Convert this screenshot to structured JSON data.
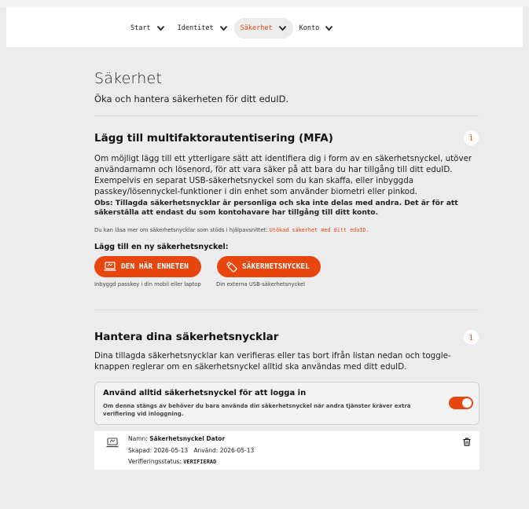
{
  "nav": {
    "items": [
      {
        "label": "Start"
      },
      {
        "label": "Identitet"
      },
      {
        "label": "Säkerhet"
      },
      {
        "label": "Konto"
      }
    ]
  },
  "page": {
    "title": "Säkerhet",
    "lead": "Öka och hantera säkerheten för ditt eduID."
  },
  "mfa": {
    "heading": "Lägg till multifaktorautentisering (MFA)",
    "info_icon": "i",
    "description": "Om möjligt lägg till ett ytterligare sätt att identifiera dig i form av en säkerhetsnyckel, utöver användarnamn och lösenord, för att vara säker på att bara du har tillgång till ditt eduID. Exempelvis en separat USB-säkerhetsnyckel som du kan skaffa, eller inbyggda passkey/lösennyckel-funktioner i din enhet som använder biometri eller pinkod.",
    "note": "Obs: Tillagda säkerhetsnycklar är personliga och ska inte delas med andra. Det är för att säkerställa att endast du som kontohavare har tillgång till ditt konto.",
    "help_prefix": "Du kan läsa mer om säkerhetsnycklar som stöds i hjälpavsnittet: ",
    "help_link": "Utökad säkerhet med ditt eduID.",
    "add_label": "Lägg till en ny säkerhetsnyckel:",
    "btn_device": "DEN HÄR ENHETEN",
    "btn_device_caption": "Inbyggd passkey i din mobil eller laptop",
    "btn_key": "SÄKERHETSNYCKEL",
    "btn_key_caption": "Din externa USB-säkerhetsnyckel"
  },
  "manage": {
    "heading": "Hantera dina säkerhetsnycklar",
    "info_icon": "i",
    "description": "Dina tillagda säkerhetsnycklar kan verifieras eller tas bort ifrån listan nedan och toggle-knappen reglerar om en säkerhetsnyckel alltid ska användas med ditt eduID.",
    "toggle_title": "Använd alltid säkerhetsnyckel för att logga in",
    "toggle_desc": "Om denna stängs av behöver du bara använda din säkerhetsnyckel när andra tjänster kräver extra verifiering vid inloggning.",
    "toggle_on": true
  },
  "key": {
    "name_label": "Namn: ",
    "name": "Säkerhetsnyckel Dator",
    "created_label": "Skapad: ",
    "created": "2026-05-13",
    "used_label": "Använd: ",
    "used": "2026-05-13",
    "status_label": "Verifieringsstatus: ",
    "status": "VERIFIERAD"
  },
  "icons": {
    "nav_chevron": "chevron-down-icon",
    "device_button": "laptop-icon",
    "key_button": "usb-key-icon",
    "key_card": "laptop-icon",
    "delete": "trash-icon"
  },
  "colors": {
    "accent": "#e8460f",
    "background": "#ececec",
    "card": "#ffffff"
  }
}
